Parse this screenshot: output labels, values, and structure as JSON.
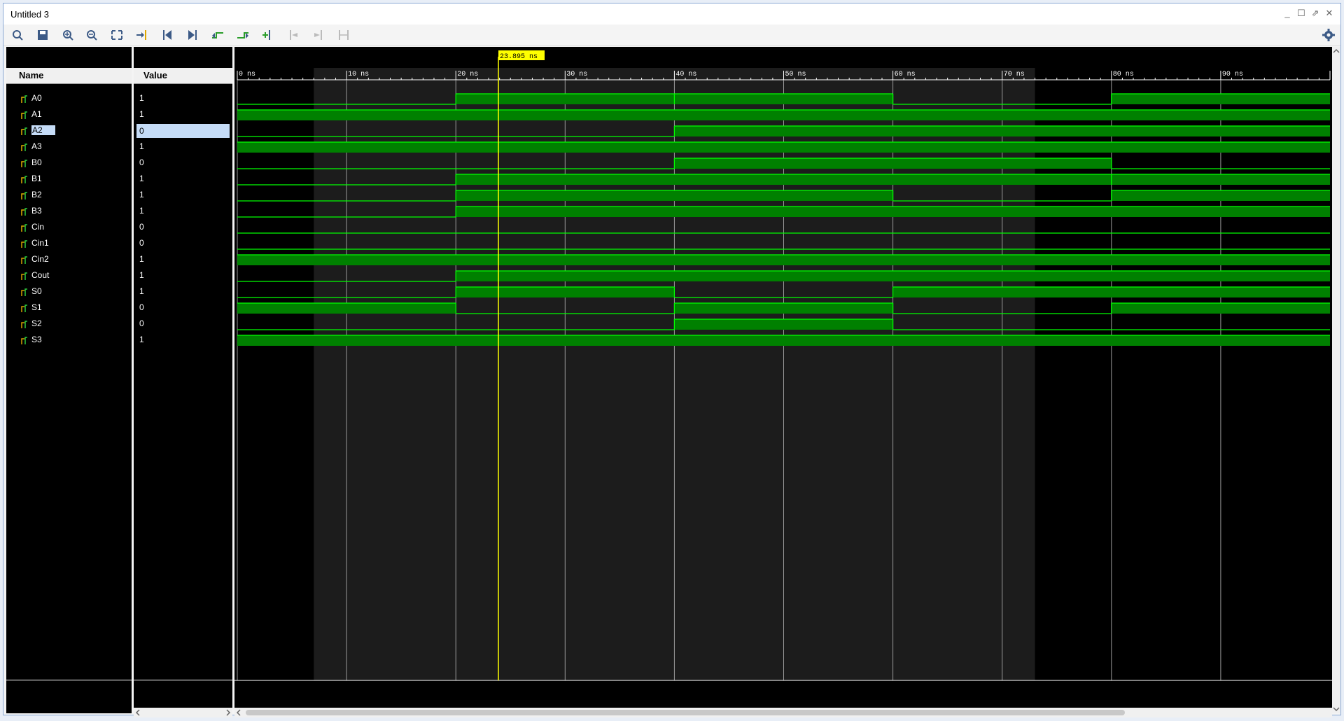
{
  "window": {
    "title": "Untitled 3"
  },
  "window_controls": [
    "minimize",
    "maximize",
    "restore",
    "close"
  ],
  "toolbar": {
    "buttons": [
      {
        "name": "search-icon",
        "enabled": true
      },
      {
        "name": "save-icon",
        "enabled": true
      },
      {
        "name": "zoom-in-icon",
        "enabled": true
      },
      {
        "name": "zoom-out-icon",
        "enabled": true
      },
      {
        "name": "zoom-fit-icon",
        "enabled": true
      },
      {
        "name": "go-to-cursor-icon",
        "enabled": true
      },
      {
        "name": "go-to-time-0-icon",
        "enabled": true
      },
      {
        "name": "go-to-last-time-icon",
        "enabled": true
      },
      {
        "name": "previous-transition-icon",
        "enabled": true
      },
      {
        "name": "next-transition-icon",
        "enabled": true
      },
      {
        "name": "add-marker-icon",
        "enabled": true
      },
      {
        "name": "previous-marker-icon",
        "enabled": false
      },
      {
        "name": "next-marker-icon",
        "enabled": false
      },
      {
        "name": "swap-cursors-icon",
        "enabled": false
      }
    ],
    "settings": "gear-icon"
  },
  "columns": {
    "name": "Name",
    "value": "Value"
  },
  "signals": [
    {
      "name": "A0",
      "value": "1",
      "icon": "input-signal-icon"
    },
    {
      "name": "A1",
      "value": "1",
      "icon": "input-signal-icon"
    },
    {
      "name": "A2",
      "value": "0",
      "icon": "input-signal-icon",
      "selected": true
    },
    {
      "name": "A3",
      "value": "1",
      "icon": "input-signal-icon"
    },
    {
      "name": "B0",
      "value": "0",
      "icon": "input-signal-icon"
    },
    {
      "name": "B1",
      "value": "1",
      "icon": "input-signal-icon"
    },
    {
      "name": "B2",
      "value": "1",
      "icon": "input-signal-icon"
    },
    {
      "name": "B3",
      "value": "1",
      "icon": "input-signal-icon"
    },
    {
      "name": "Cin",
      "value": "0",
      "icon": "input-signal-icon"
    },
    {
      "name": "Cin1",
      "value": "0",
      "icon": "output-signal-icon"
    },
    {
      "name": "Cin2",
      "value": "1",
      "icon": "output-signal-icon"
    },
    {
      "name": "Cout",
      "value": "1",
      "icon": "output-signal-icon"
    },
    {
      "name": "S0",
      "value": "1",
      "icon": "output-signal-icon"
    },
    {
      "name": "S1",
      "value": "0",
      "icon": "output-signal-icon"
    },
    {
      "name": "S2",
      "value": "0",
      "icon": "output-signal-icon"
    },
    {
      "name": "S3",
      "value": "1",
      "icon": "output-signal-icon"
    }
  ],
  "timeline": {
    "unit": "ns",
    "range_ns": [
      0,
      100
    ],
    "major_ticks": [
      "0 ns",
      "10 ns",
      "20 ns",
      "30 ns",
      "40 ns",
      "50 ns",
      "60 ns",
      "70 ns",
      "80 ns",
      "90 ns"
    ],
    "cursor_ns": 23.895,
    "cursor_label": "23.895 ns"
  },
  "waveforms": {
    "A0": [
      [
        0,
        0
      ],
      [
        20,
        1
      ],
      [
        40,
        1
      ],
      [
        60,
        0
      ],
      [
        80,
        1
      ]
    ],
    "A1": [
      [
        0,
        1
      ]
    ],
    "A2": [
      [
        0,
        0
      ],
      [
        40,
        1
      ]
    ],
    "A3": [
      [
        0,
        1
      ]
    ],
    "B0": [
      [
        0,
        0
      ],
      [
        40,
        1
      ],
      [
        80,
        0
      ]
    ],
    "B1": [
      [
        0,
        0
      ],
      [
        20,
        1
      ],
      [
        80,
        0
      ],
      [
        80,
        1
      ]
    ],
    "B2": [
      [
        0,
        0
      ],
      [
        20,
        1
      ],
      [
        60,
        0
      ],
      [
        80,
        1
      ]
    ],
    "B3": [
      [
        0,
        0
      ],
      [
        20,
        1
      ]
    ],
    "Cin": [
      [
        0,
        0
      ]
    ],
    "Cin1": [
      [
        0,
        0
      ]
    ],
    "Cin2": [
      [
        0,
        1
      ]
    ],
    "Cout": [
      [
        0,
        0
      ],
      [
        20,
        1
      ]
    ],
    "S0": [
      [
        0,
        0
      ],
      [
        20,
        1
      ],
      [
        40,
        0
      ],
      [
        60,
        1
      ]
    ],
    "S1": [
      [
        0,
        1
      ],
      [
        20,
        0
      ],
      [
        40,
        1
      ],
      [
        60,
        0
      ],
      [
        80,
        1
      ]
    ],
    "S2": [
      [
        0,
        0
      ],
      [
        40,
        1
      ],
      [
        60,
        0
      ]
    ],
    "S3": [
      [
        0,
        1
      ]
    ]
  },
  "colors": {
    "wave_high": "#008000",
    "wave_line": "#00ff00",
    "cursor": "#ffff00",
    "background": "#000000",
    "selection": "#c5dcf7"
  }
}
